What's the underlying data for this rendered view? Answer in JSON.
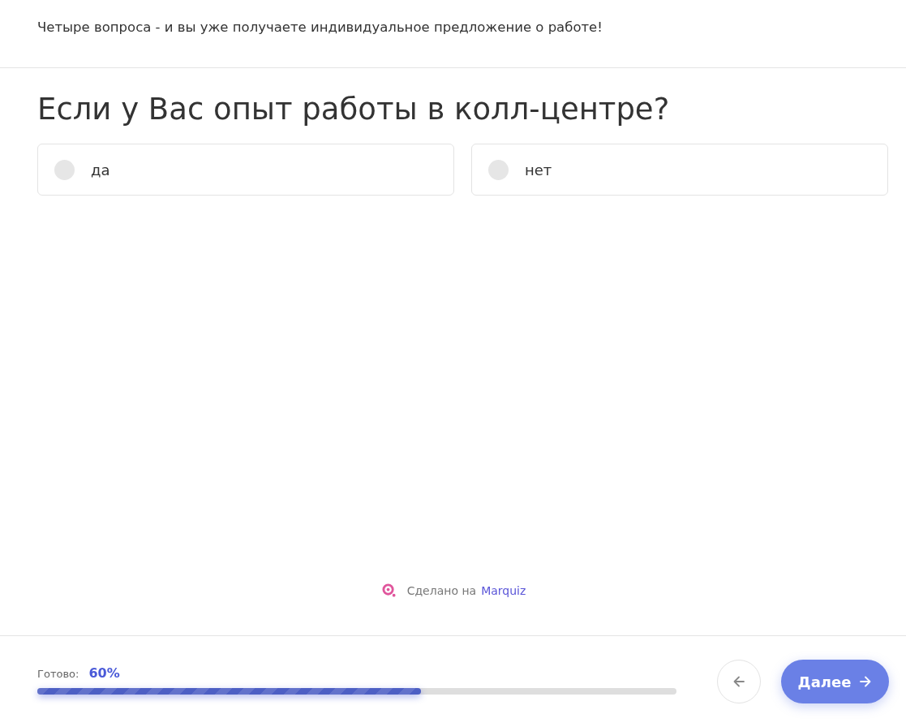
{
  "header": {
    "text": "Четыре вопроса - и вы уже получаете индивидуальное предложение о работе!"
  },
  "question": {
    "title": "Если у Вас опыт работы в колл-центре?",
    "options": [
      {
        "label": "да",
        "selected": false
      },
      {
        "label": "нет",
        "selected": false
      }
    ]
  },
  "credit": {
    "prefix": "Сделано на",
    "link": "Marquiz"
  },
  "footer": {
    "progress": {
      "label": "Готово:",
      "value": "60%",
      "level": 0.6
    },
    "next_button": {
      "label": "Далее"
    }
  }
}
